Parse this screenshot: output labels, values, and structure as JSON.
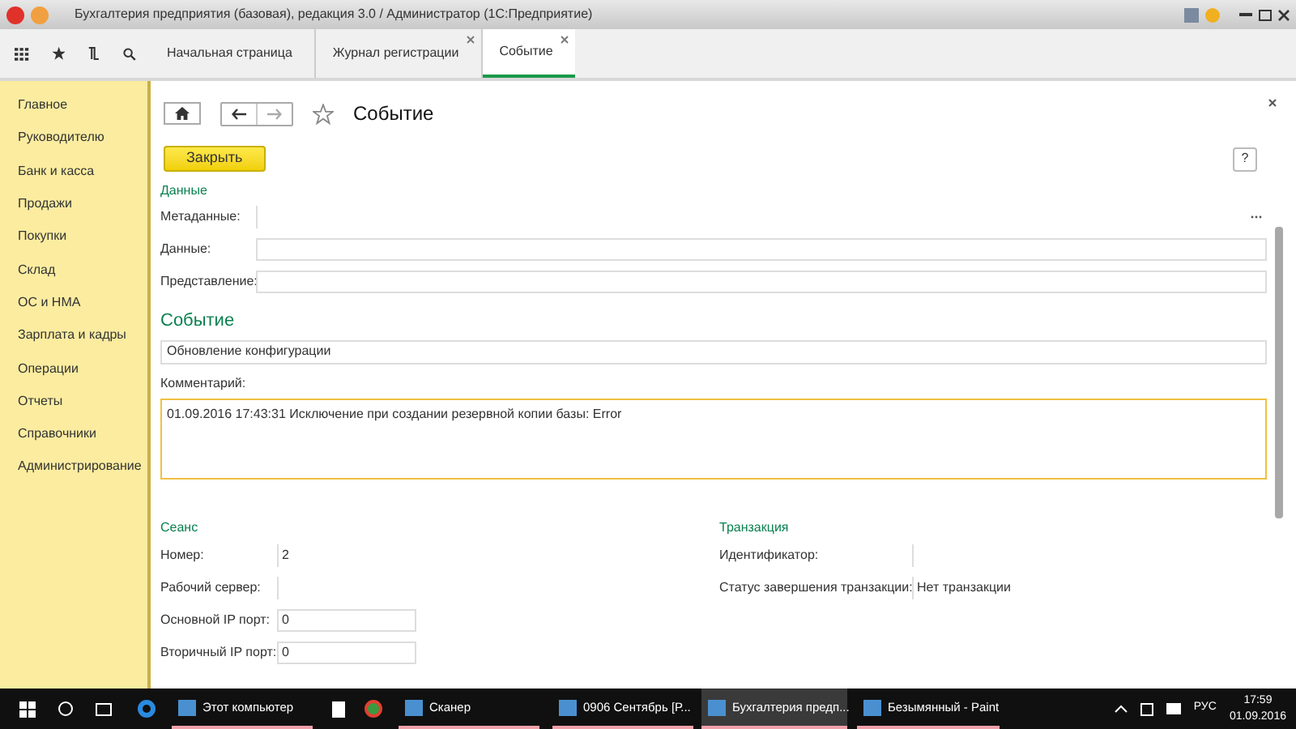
{
  "window": {
    "title": "Бухгалтерия предприятия (базовая), редакция 3.0 / Администратор  (1С:Предприятие)"
  },
  "tabs": [
    {
      "label": "Начальная страница",
      "selected": false,
      "closable": false
    },
    {
      "label": "Журнал регистрации",
      "selected": false,
      "closable": true
    },
    {
      "label": "Событие",
      "selected": true,
      "closable": true
    }
  ],
  "sidebar": {
    "items": [
      {
        "label": "Главное"
      },
      {
        "label": "Руководителю"
      },
      {
        "label": "Банк и касса"
      },
      {
        "label": "Продажи"
      },
      {
        "label": "Покупки"
      },
      {
        "label": "Склад"
      },
      {
        "label": "ОС и НМА"
      },
      {
        "label": "Зарплата и кадры"
      },
      {
        "label": "Операции"
      },
      {
        "label": "Отчеты"
      },
      {
        "label": "Справочники"
      },
      {
        "label": "Администрирование"
      }
    ]
  },
  "form": {
    "title": "Событие",
    "close_button": "Закрыть",
    "help_button": "?",
    "data_section": {
      "heading": "Данные",
      "fields": [
        {
          "label": "Метаданные:",
          "kind": "choice"
        },
        {
          "label": "Данные:",
          "kind": "text"
        },
        {
          "label": "Представление:",
          "kind": "text"
        }
      ]
    },
    "event_section": {
      "heading": "Событие",
      "value": "Обновление конфигурации",
      "comment_label": "Комментарий:",
      "comment": "01.09.2016 17:43:31 Исключение при создании резервной копии базы: Error"
    },
    "session": {
      "heading": "Сеанс",
      "fields": [
        {
          "label": "Номер:",
          "value": "2",
          "kind": "plain"
        },
        {
          "label": "Рабочий сервер:",
          "kind": "plain"
        },
        {
          "label": "Основной IP порт:",
          "value": "0",
          "kind": "boxed"
        },
        {
          "label": "Вторичный IP порт:",
          "value": "0",
          "kind": "boxed"
        }
      ]
    },
    "transaction": {
      "heading": "Транзакция",
      "fields": [
        {
          "label": "Идентификатор:"
        },
        {
          "label": "Статус завершения транзакции:",
          "value": "Нет транзакции"
        }
      ]
    }
  },
  "taskbar": {
    "items": [
      {
        "label": "Этот компьютер",
        "selected": false
      },
      {
        "label": "Сканер",
        "selected": false
      },
      {
        "label": "0906 Сентябрь [Р...",
        "selected": false
      },
      {
        "label": "Бухгалтерия предп...",
        "selected": true
      },
      {
        "label": "Безымянный - Paint",
        "selected": false
      }
    ],
    "language": "РУС",
    "time": "17:59",
    "date": "01.09.2016"
  }
}
